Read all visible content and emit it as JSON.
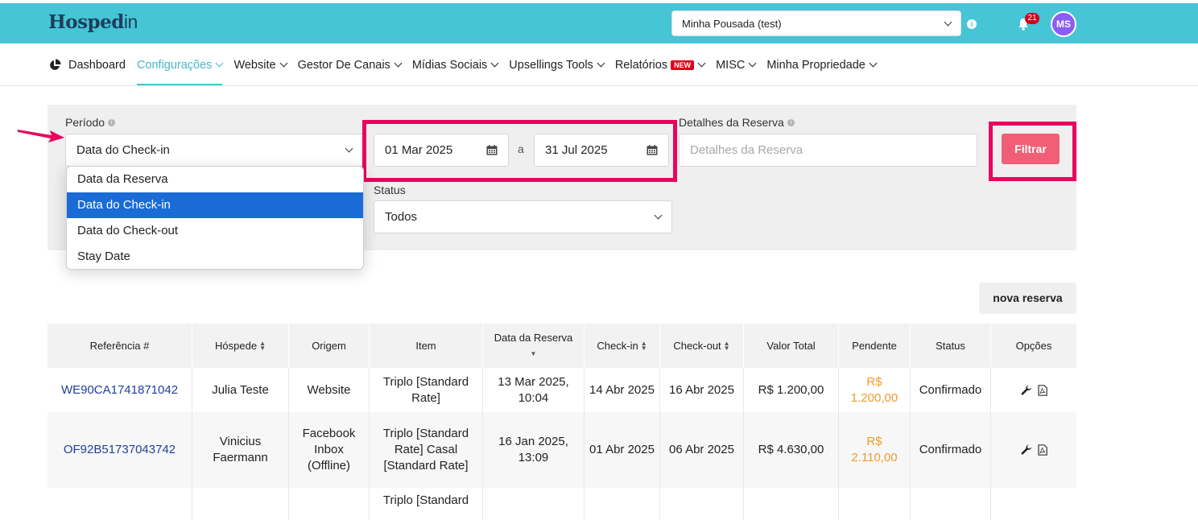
{
  "app": {
    "logo_main": "Hosped",
    "logo_suffix": "in"
  },
  "topbar": {
    "property": "Minha Pousada (test)",
    "notifications_count": "21",
    "avatar_initials": "MS",
    "accent_color": "#45c5d6"
  },
  "nav": {
    "items": [
      {
        "label": "Dashboard"
      },
      {
        "label": "Configurações"
      },
      {
        "label": "Website"
      },
      {
        "label": "Gestor De Canais"
      },
      {
        "label": "Mídias Sociais"
      },
      {
        "label": "Upsellings Tools"
      },
      {
        "label": "Relatórios"
      },
      {
        "label": "MISC"
      },
      {
        "label": "Minha Propriedade"
      }
    ],
    "new_badge": "NEW"
  },
  "filters": {
    "periodo_label": "Período",
    "periodo_value": "Data do Check-in",
    "periodo_options": [
      "Data da Reserva",
      "Data do Check-in",
      "Data do Check-out",
      "Stay Date"
    ],
    "date_from": "01 Mar 2025",
    "date_sep": "a",
    "date_to": "31 Jul 2025",
    "detalhes_label": "Detalhes da Reserva",
    "detalhes_placeholder": "Detalhes da Reserva",
    "status_label": "Status",
    "status_value": "Todos",
    "filter_button": "Filtrar"
  },
  "new_reservation_button": "nova reserva",
  "table": {
    "headers": [
      "Referência #",
      "Hóspede",
      "Origem",
      "Item",
      "Data da Reserva",
      "Check-in",
      "Check-out",
      "Valor Total",
      "Pendente",
      "Status",
      "Opções"
    ],
    "rows": [
      {
        "ref": "WE90CA1741871042",
        "guest": "Julia Teste",
        "origin": "Website",
        "item": "Triplo [Standard Rate]",
        "booking_date": "13 Mar 2025, 10:04",
        "checkin": "14 Abr 2025",
        "checkout": "16 Abr 2025",
        "total": "R$ 1.200,00",
        "pending": "R$ 1.200,00",
        "status": "Confirmado"
      },
      {
        "ref": "OF92B51737043742",
        "guest": "Vinicius Faermann",
        "origin": "Facebook Inbox (Offline)",
        "item": "Triplo [Standard Rate] Casal [Standard Rate]",
        "booking_date": "16 Jan 2025, 13:09",
        "checkin": "01 Abr 2025",
        "checkout": "06 Abr 2025",
        "total": "R$ 4.630,00",
        "pending": "R$ 2.110,00",
        "status": "Confirmado"
      },
      {
        "item": "Triplo [Standard"
      }
    ]
  }
}
